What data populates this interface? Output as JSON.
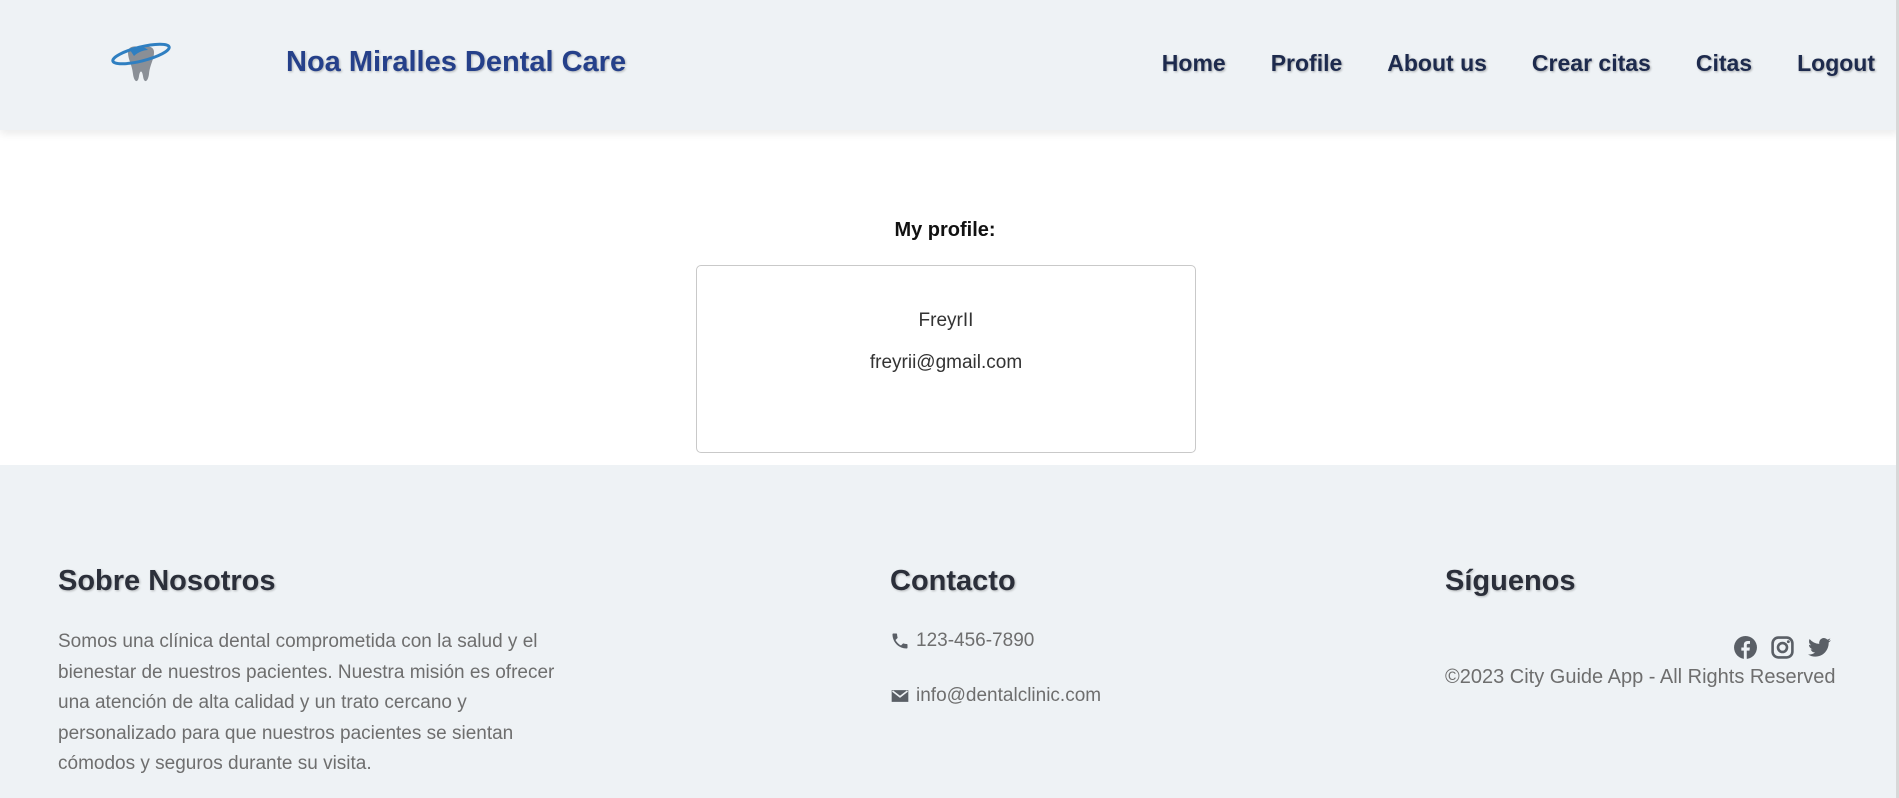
{
  "header": {
    "logo_icon": "tooth-logo-icon",
    "brand_name": "Noa Miralles Dental Care",
    "nav": [
      {
        "label": "Home"
      },
      {
        "label": "Profile"
      },
      {
        "label": "About us"
      },
      {
        "label": "Crear citas"
      },
      {
        "label": "Citas"
      },
      {
        "label": "Logout"
      }
    ]
  },
  "profile": {
    "title": "My profile:",
    "name": "FreyrII",
    "email": "freyrii@gmail.com"
  },
  "footer": {
    "about": {
      "heading": "Sobre Nosotros",
      "text": "Somos una clínica dental comprometida con la salud y el bienestar de nuestros pacientes. Nuestra misión es ofrecer una atención de alta calidad y un trato cercano y personalizado para que nuestros pacientes se sientan cómodos y seguros durante su visita."
    },
    "contact": {
      "heading": "Contacto",
      "phone_icon": "phone-icon",
      "phone": "123-456-7890",
      "email_icon": "envelope-icon",
      "email": "info@dentalclinic.com"
    },
    "follow": {
      "heading": "Síguenos",
      "icons": [
        "facebook-icon",
        "instagram-icon",
        "twitter-icon"
      ],
      "copyright": "©2023 City Guide App - All Rights Reserved"
    }
  },
  "colors": {
    "brand": "#25408a",
    "nav_text": "#1d2a4d",
    "band_bg": "#eef2f5",
    "muted_text": "#6e6e6e"
  }
}
